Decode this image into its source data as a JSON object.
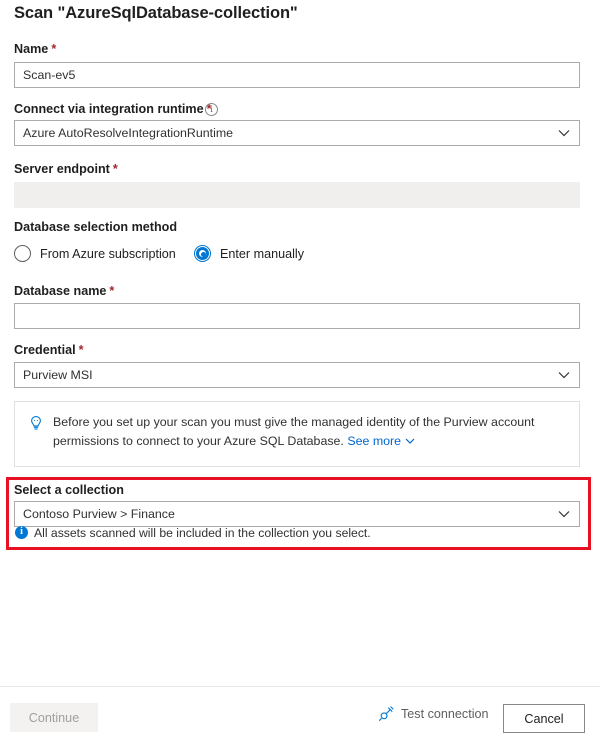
{
  "dialog": {
    "title": "Scan \"AzureSqlDatabase-collection\""
  },
  "fields": {
    "name": {
      "label": "Name",
      "required_marker": "*",
      "value": "Scan-ev5"
    },
    "integration_runtime": {
      "label": "Connect via integration runtime",
      "required_marker": "*",
      "info_icon": "info-circle-icon",
      "value": "Azure AutoResolveIntegrationRuntime",
      "chevron": "chevron-down-icon"
    },
    "server_endpoint": {
      "label": "Server endpoint",
      "required_marker": "*",
      "value": "",
      "disabled": true
    },
    "database_selection_method": {
      "label": "Database selection method",
      "options": [
        {
          "label": "From Azure subscription",
          "selected": false
        },
        {
          "label": "Enter manually",
          "selected": true
        }
      ]
    },
    "database_name": {
      "label": "Database name",
      "required_marker": "*",
      "value": ""
    },
    "credential": {
      "label": "Credential",
      "required_marker": "*",
      "value": "Purview MSI",
      "chevron": "chevron-down-icon"
    },
    "collection": {
      "label": "Select a collection",
      "value": "Contoso Purview > Finance",
      "chevron": "chevron-down-icon",
      "hint": "All assets scanned will be included in the collection you select.",
      "hint_icon": "info-filled-icon"
    }
  },
  "banner": {
    "icon": "lightbulb-icon",
    "text_line1": "Before you set up your scan you must give the managed identity of the Purview account",
    "text_line2": "permissions to connect to your Azure SQL Database.",
    "link_label": "See more",
    "link_chevron": "chevron-down-icon"
  },
  "footer": {
    "continue_label": "Continue",
    "test_connection_label": "Test connection",
    "test_connection_icon": "plug-connector-icon",
    "cancel_label": "Cancel"
  },
  "colors": {
    "accent": "#0078d4",
    "link": "#0066cc",
    "required": "#a4262c",
    "highlight": "#e81123",
    "text": "#201f1e",
    "border": "#adabaa",
    "disabled_bg": "#f0efee"
  }
}
